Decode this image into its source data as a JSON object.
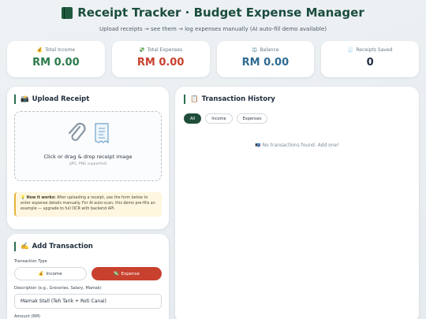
{
  "header": {
    "title": "Receipt Tracker · Budget Expense Manager",
    "subtitle": "Upload receipts → see them → log expenses manually (AI auto-fill demo available)"
  },
  "stats": [
    {
      "icon": "💰",
      "label": "Total Income",
      "value": "RM 0.00",
      "color": "#2c7a4b"
    },
    {
      "icon": "💸",
      "label": "Total Expenses",
      "value": "RM 0.00",
      "color": "#c8412f"
    },
    {
      "icon": "⚖️",
      "label": "Balance",
      "value": "RM 0.00",
      "color": "#2f6b91"
    },
    {
      "icon": "🧾",
      "label": "Receipts Saved",
      "value": "0",
      "color": "#1f2d3d"
    }
  ],
  "upload": {
    "title": "Upload Receipt",
    "title_icon": "📸",
    "drop_text": "Click or drag & drop receipt image",
    "drop_sub": "(JPG, PNG supported)",
    "info_icon": "💡",
    "info_bold": "How it works:",
    "info_text": "After uploading a receipt, use the form below to enter expense details manually. For AI auto-scan, this demo pre-fills an example — upgrade to full OCR with backend API."
  },
  "add": {
    "title": "Add Transaction",
    "title_icon": "✍️",
    "type_label": "Transaction Type",
    "income_icon": "💰",
    "income_label": "Income",
    "expense_icon": "💸",
    "expense_label": "Expense",
    "desc_label": "Description (e.g., Groceries, Salary, Mamak)",
    "desc_value": "Mamak Stall (Teh Tarik + Roti Canai)",
    "amount_label": "Amount (RM)"
  },
  "history": {
    "title": "Transaction History",
    "title_icon": "📋",
    "filters": [
      "All",
      "Income",
      "Expenses"
    ],
    "empty_icon": "📭",
    "empty_text": "No transactions found. Add one!"
  }
}
